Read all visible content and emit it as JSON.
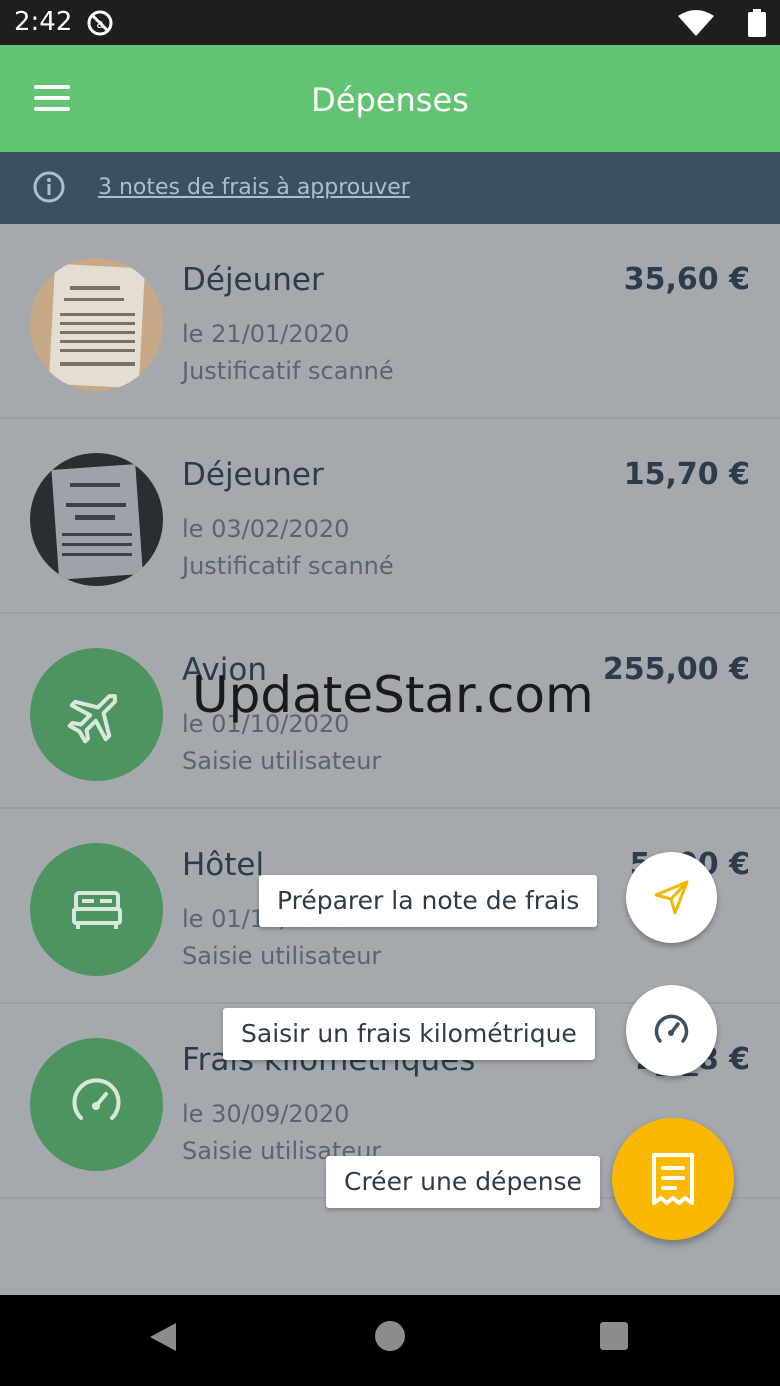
{
  "status_bar": {
    "time": "2:42"
  },
  "app_bar": {
    "title": "Dépenses"
  },
  "banner": {
    "text": "3 notes de frais à approuver"
  },
  "expenses": [
    {
      "name": "Déjeuner",
      "date": "le 21/01/2020",
      "source": "Justificatif scanné",
      "amount": "35,60 €",
      "icon": "receipt-photo"
    },
    {
      "name": "Déjeuner",
      "date": "le 03/02/2020",
      "source": "Justificatif scanné",
      "amount": "15,70 €",
      "icon": "receipt-photo"
    },
    {
      "name": "Avion",
      "date": "le 01/10/2020",
      "source": "Saisie utilisateur",
      "amount": "255,00 €",
      "icon": "plane-icon"
    },
    {
      "name": "Hôtel",
      "date": "le 01/10/2020",
      "source": "Saisie utilisateur",
      "amount": "5_,00 €",
      "icon": "bed-icon"
    },
    {
      "name": "Frais kilométriques",
      "date": "le 30/09/2020",
      "source": "Saisie utilisateur",
      "amount": "2_,_8 €",
      "icon": "speedometer-icon"
    }
  ],
  "watermark": "UpdateStar.com",
  "fab_menu": {
    "prepare_label": "Préparer la note de frais",
    "mileage_label": "Saisir un frais kilométrique",
    "create_label": "Créer une dépense"
  },
  "colors": {
    "primary": "#62c473",
    "banner": "#3d5062",
    "fab": "#fbb800",
    "avatar": "#4e9461"
  }
}
